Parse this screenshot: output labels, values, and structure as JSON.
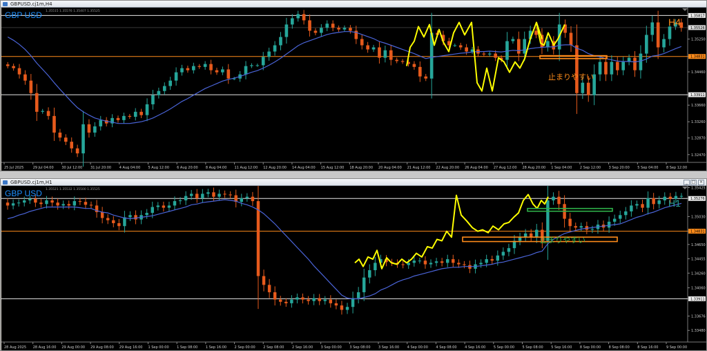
{
  "windows": [
    {
      "id": "h4",
      "title": "GBPUSD.cj1m,H4"
    },
    {
      "id": "h1",
      "title": "GBPUSD.cj1m,H1"
    }
  ],
  "colors": {
    "bg": "#000000",
    "bull": "#26a69a",
    "bear": "#e65a1c",
    "ma": "#4a64d8",
    "swing": "#ffff00",
    "orange": "#ff8c1a",
    "green": "#2fb24a",
    "white": "#e8e8e8",
    "cyanLabel": "#1e90ff",
    "h1label": "#2aa198"
  },
  "chart_data": [
    {
      "type": "candlestick",
      "title": "GBP USD",
      "timeframe": "H4",
      "ohlc_line": "1.35515 1.35576 1.35407 1.35525",
      "ylim": [
        1.3235,
        1.3594
      ],
      "y_ticks": [
        "1.35817",
        "1.35526",
        "1.35250",
        "1.34831",
        "1.34460",
        "1.33911",
        "1.33660",
        "1.33260",
        "1.32870",
        "1.32470"
      ],
      "x_ticks": [
        "25 Jul 2025",
        "29 Jul 04:00",
        "30 Jul 12:00",
        "31 Jul 20:00",
        "4 Aug 04:00",
        "5 Aug 12:00",
        "6 Aug 20:00",
        "8 Aug 04:00",
        "11 Aug 12:00",
        "12 Aug 20:00",
        "14 Aug 04:00",
        "15 Aug 12:00",
        "18 Aug 20:00",
        "20 Aug 04:00",
        "21 Aug 12:00",
        "22 Aug 20:00",
        "26 Aug 04:00",
        "27 Aug 12:00",
        "28 Aug 20:00",
        "1 Sep 04:00",
        "2 Sep 12:00",
        "3 Sep 20:00",
        "5 Sep 04:00",
        "8 Sep 12:00"
      ],
      "levels": [
        {
          "price": 1.35817,
          "label": "1.35817",
          "color": "white"
        },
        {
          "price": 1.34831,
          "label": "1.34831",
          "color": "orange"
        },
        {
          "price": 1.33911,
          "label": "1.33911",
          "color": "white"
        }
      ],
      "current_price": "1.35526",
      "annotation": "止まりやすい",
      "label_tf": "H4",
      "closes": [
        1.346,
        1.3455,
        1.344,
        1.3425,
        1.3395,
        1.335,
        1.3352,
        1.334,
        1.33,
        1.3288,
        1.3278,
        1.3262,
        1.325,
        1.332,
        1.33,
        1.3315,
        1.333,
        1.3322,
        1.3335,
        1.333,
        1.334,
        1.3338,
        1.335,
        1.3342,
        1.3368,
        1.339,
        1.34,
        1.3412,
        1.3425,
        1.3445,
        1.3455,
        1.345,
        1.346,
        1.3458,
        1.3465,
        1.345,
        1.3445,
        1.3452,
        1.343,
        1.343,
        1.344,
        1.346,
        1.3462,
        1.3462,
        1.3482,
        1.3495,
        1.351,
        1.353,
        1.356,
        1.3575,
        1.3585,
        1.357,
        1.3545,
        1.354,
        1.3552,
        1.3562,
        1.3552,
        1.3548,
        1.3552,
        1.3545,
        1.3525,
        1.351,
        1.35,
        1.3505,
        1.348,
        1.3498,
        1.3475,
        1.3472,
        1.347,
        1.3465,
        1.3458,
        1.3435,
        1.343,
        1.354,
        1.3535,
        1.352,
        1.351,
        1.351,
        1.3505,
        1.3495,
        1.35,
        1.349,
        1.3488,
        1.349,
        1.348,
        1.3475,
        1.352,
        1.3525,
        1.349,
        1.3525,
        1.3545,
        1.3535,
        1.3505,
        1.352,
        1.35,
        1.356,
        1.354,
        1.351,
        1.3395,
        1.342,
        1.339,
        1.344,
        1.347,
        1.344,
        1.347,
        1.345,
        1.347,
        1.348,
        1.345,
        1.349,
        1.3535,
        1.3565,
        1.3505,
        1.3525,
        1.3555,
        1.3565,
        1.3552
      ],
      "ma": [
        1.353,
        1.3522,
        1.3512,
        1.35,
        1.3485,
        1.3467,
        1.3452,
        1.3437,
        1.342,
        1.3404,
        1.3389,
        1.3374,
        1.336,
        1.335,
        1.3342,
        1.3335,
        1.3331,
        1.3327,
        1.3325,
        1.3322,
        1.3322,
        1.3322,
        1.3324,
        1.3326,
        1.333,
        1.3335,
        1.3342,
        1.3349,
        1.3357,
        1.3366,
        1.3375,
        1.3382,
        1.339,
        1.3398,
        1.3406,
        1.3412,
        1.3418,
        1.3424,
        1.3428,
        1.3431,
        1.3435,
        1.344,
        1.3445,
        1.3449,
        1.3455,
        1.3462,
        1.347,
        1.3479,
        1.3489,
        1.3499,
        1.3509,
        1.3516,
        1.3521,
        1.3526,
        1.3531,
        1.3536,
        1.3539,
        1.3541,
        1.3543,
        1.3543,
        1.3541,
        1.3536,
        1.3531,
        1.3526,
        1.3519,
        1.3515,
        1.351,
        1.3505,
        1.35,
        1.3495,
        1.349,
        1.3484,
        1.3478,
        1.3481,
        1.3483,
        1.3485,
        1.3487,
        1.3489,
        1.3491,
        1.3492,
        1.3494,
        1.3495,
        1.3495,
        1.3496,
        1.3495,
        1.3494,
        1.3496,
        1.3498,
        1.3497,
        1.3499,
        1.3502,
        1.3504,
        1.3505,
        1.3506,
        1.3506,
        1.351,
        1.3511,
        1.3511,
        1.3503,
        1.3498,
        1.349,
        1.3485,
        1.3482,
        1.3478,
        1.3475,
        1.3472,
        1.3471,
        1.3471,
        1.347,
        1.3472,
        1.3477,
        1.3484,
        1.3486,
        1.349,
        1.3496,
        1.3502,
        1.3507
      ],
      "swing": [
        [
          587,
          1.346
        ],
        [
          592,
          1.3505
        ],
        [
          598,
          1.352
        ],
        [
          604,
          1.3555
        ],
        [
          612,
          1.353
        ],
        [
          620,
          1.356
        ],
        [
          627,
          1.351
        ],
        [
          634,
          1.3548
        ],
        [
          640,
          1.3518
        ],
        [
          648,
          1.3495
        ],
        [
          655,
          1.354
        ],
        [
          663,
          1.3565
        ],
        [
          671,
          1.3535
        ],
        [
          681,
          1.3565
        ],
        [
          689,
          1.342
        ],
        [
          696,
          1.34
        ],
        [
          703,
          1.3455
        ],
        [
          711,
          1.34
        ],
        [
          720,
          1.348
        ],
        [
          728,
          1.347
        ],
        [
          736,
          1.3445
        ],
        [
          744,
          1.347
        ],
        [
          751,
          1.3455
        ],
        [
          758,
          1.3478
        ],
        [
          766,
          1.3525
        ],
        [
          775,
          1.3565
        ],
        [
          781,
          1.3515
        ],
        [
          786,
          1.351
        ],
        [
          792,
          1.354
        ],
        [
          800,
          1.351
        ],
        [
          806,
          1.3525
        ],
        [
          816,
          1.356
        ]
      ],
      "swing2": [
        [
          775,
          1.3565
        ],
        [
          783,
          1.3525
        ]
      ],
      "box": {
        "x1": 780,
        "x2": 877,
        "p1": 1.3485,
        "p2": 1.3478,
        "color": "orange"
      }
    },
    {
      "type": "candlestick",
      "title": "GBP USD",
      "timeframe": "H1",
      "ohlc_line": "1.35521 1.35532 1.35500 1.35525",
      "ylim": [
        1.3336,
        1.3541
      ],
      "y_ticks": [
        "1.35526",
        "1.35425",
        "1.35276",
        "1.35030",
        "1.34831",
        "1.34650",
        "1.34455",
        "1.34260",
        "1.34060",
        "1.33911",
        "1.33676",
        "1.33480"
      ],
      "x_ticks": [
        "28 Aug 2025",
        "28 Aug 16:00",
        "29 Aug 00:00",
        "29 Aug 08:00",
        "29 Aug 16:00",
        "1 Sep 00:00",
        "1 Sep 08:00",
        "1 Sep 16:00",
        "2 Sep 00:00",
        "2 Sep 08:00",
        "2 Sep 16:00",
        "3 Sep 00:00",
        "3 Sep 08:00",
        "3 Sep 16:00",
        "4 Sep 00:00",
        "4 Sep 08:00",
        "4 Sep 16:00",
        "5 Sep 00:00",
        "5 Sep 08:00",
        "5 Sep 16:00",
        "8 Sep 00:00",
        "8 Sep 08:00",
        "8 Sep 16:00",
        "9 Sep 00:00"
      ],
      "levels": [
        {
          "price": 1.35276,
          "label": "1.35276",
          "color": "white"
        },
        {
          "price": 1.34831,
          "label": "1.34831",
          "color": "orange"
        },
        {
          "price": 1.33911,
          "label": "1.33911",
          "color": "white"
        }
      ],
      "current_price": "1.35526",
      "annotation": "止まりやすい",
      "label_tf": "H1",
      "closes": [
        1.3518,
        1.3521,
        1.3522,
        1.3525,
        1.3527,
        1.3522,
        1.352,
        1.3525,
        1.3522,
        1.3518,
        1.352,
        1.3518,
        1.3524,
        1.3523,
        1.3519,
        1.3518,
        1.3509,
        1.3501,
        1.3498,
        1.3494,
        1.349,
        1.3502,
        1.3505,
        1.3499,
        1.3505,
        1.3508,
        1.3516,
        1.3518,
        1.3515,
        1.3518,
        1.3524,
        1.3525,
        1.3531,
        1.3534,
        1.3528,
        1.3534,
        1.3536,
        1.353,
        1.3534,
        1.3533,
        1.3532,
        1.3523,
        1.3528,
        1.353,
        1.3524,
        1.3422,
        1.341,
        1.34,
        1.339,
        1.3387,
        1.3385,
        1.339,
        1.3393,
        1.339,
        1.3388,
        1.3392,
        1.3388,
        1.339,
        1.3385,
        1.3382,
        1.3376,
        1.338,
        1.3392,
        1.34,
        1.342,
        1.343,
        1.344,
        1.3445,
        1.3441,
        1.344,
        1.3438,
        1.3437,
        1.344,
        1.3443,
        1.3443,
        1.3438,
        1.344,
        1.3442,
        1.344,
        1.3445,
        1.344,
        1.3438,
        1.3437,
        1.3432,
        1.3438,
        1.344,
        1.3445,
        1.3443,
        1.345,
        1.3455,
        1.346,
        1.347,
        1.3475,
        1.348,
        1.3475,
        1.3485,
        1.347,
        1.3525,
        1.353,
        1.352,
        1.35,
        1.349,
        1.3488,
        1.349,
        1.3485,
        1.3486,
        1.3492,
        1.3488,
        1.3496,
        1.35,
        1.3505,
        1.351,
        1.3518,
        1.352,
        1.3515,
        1.3528,
        1.352,
        1.3525,
        1.353,
        1.3527,
        1.3531,
        1.3531
      ],
      "ma": [
        1.35,
        1.3502,
        1.3505,
        1.3507,
        1.351,
        1.3512,
        1.3514,
        1.3516,
        1.3516,
        1.3516,
        1.3516,
        1.3516,
        1.3516,
        1.3515,
        1.3514,
        1.3514,
        1.3511,
        1.3509,
        1.3508,
        1.3505,
        1.3503,
        1.3501,
        1.35,
        1.3501,
        1.3502,
        1.3503,
        1.3504,
        1.3506,
        1.3508,
        1.351,
        1.3512,
        1.3514,
        1.3516,
        1.3519,
        1.352,
        1.3522,
        1.3523,
        1.3524,
        1.3525,
        1.3526,
        1.3525,
        1.3524,
        1.3521,
        1.3519,
        1.3516,
        1.3512,
        1.3507,
        1.35,
        1.3493,
        1.3485,
        1.3477,
        1.3469,
        1.3461,
        1.3453,
        1.3445,
        1.3436,
        1.3428,
        1.342,
        1.3412,
        1.3404,
        1.3396,
        1.3392,
        1.3391,
        1.3391,
        1.3393,
        1.3395,
        1.3398,
        1.3403,
        1.3406,
        1.341,
        1.3414,
        1.3417,
        1.3419,
        1.3422,
        1.3424,
        1.3426,
        1.3428,
        1.343,
        1.3432,
        1.3433,
        1.3434,
        1.3434,
        1.3435,
        1.3435,
        1.3435,
        1.3436,
        1.3437,
        1.3438,
        1.344,
        1.3441,
        1.3443,
        1.3445,
        1.3447,
        1.3449,
        1.3451,
        1.3454,
        1.3456,
        1.3466,
        1.3472,
        1.3476,
        1.348,
        1.3482,
        1.3484,
        1.3486,
        1.3487,
        1.3488,
        1.3489,
        1.349,
        1.3491,
        1.3492,
        1.3493,
        1.3496,
        1.3499,
        1.3502,
        1.3504,
        1.3507,
        1.3509,
        1.3512,
        1.3515,
        1.3517,
        1.3519,
        1.3521
      ],
      "swing": [
        [
          512,
          1.344
        ],
        [
          518,
          1.3445
        ],
        [
          524,
          1.3435
        ],
        [
          531,
          1.3448
        ],
        [
          538,
          1.3445
        ],
        [
          544,
          1.3457
        ],
        [
          551,
          1.3432
        ],
        [
          558,
          1.3447
        ],
        [
          565,
          1.344
        ],
        [
          573,
          1.3438
        ],
        [
          580,
          1.3445
        ],
        [
          587,
          1.344
        ],
        [
          594,
          1.3445
        ],
        [
          601,
          1.3453
        ],
        [
          609,
          1.3448
        ],
        [
          617,
          1.3462
        ],
        [
          624,
          1.346
        ],
        [
          631,
          1.3472
        ],
        [
          638,
          1.347
        ],
        [
          645,
          1.3483
        ],
        [
          652,
          1.3475
        ],
        [
          659,
          1.3532
        ],
        [
          666,
          1.3505
        ],
        [
          674,
          1.3497
        ],
        [
          682,
          1.3488
        ],
        [
          690,
          1.3483
        ],
        [
          697,
          1.3485
        ],
        [
          705,
          1.3481
        ],
        [
          712,
          1.349
        ],
        [
          720,
          1.3485
        ],
        [
          728,
          1.3493
        ],
        [
          735,
          1.3495
        ],
        [
          742,
          1.3502
        ],
        [
          749,
          1.3508
        ],
        [
          756,
          1.3525
        ],
        [
          763,
          1.3533
        ],
        [
          770,
          1.352
        ],
        [
          776,
          1.3514
        ],
        [
          782,
          1.3525
        ],
        [
          787,
          1.352
        ],
        [
          792,
          1.353
        ]
      ],
      "box": {
        "x1": 668,
        "x2": 892,
        "p1": 1.3475,
        "p2": 1.3469,
        "color": "orange"
      },
      "box2": {
        "x1": 762,
        "x2": 885,
        "p1": 1.3514,
        "p2": 1.3511,
        "color": "green"
      }
    }
  ]
}
